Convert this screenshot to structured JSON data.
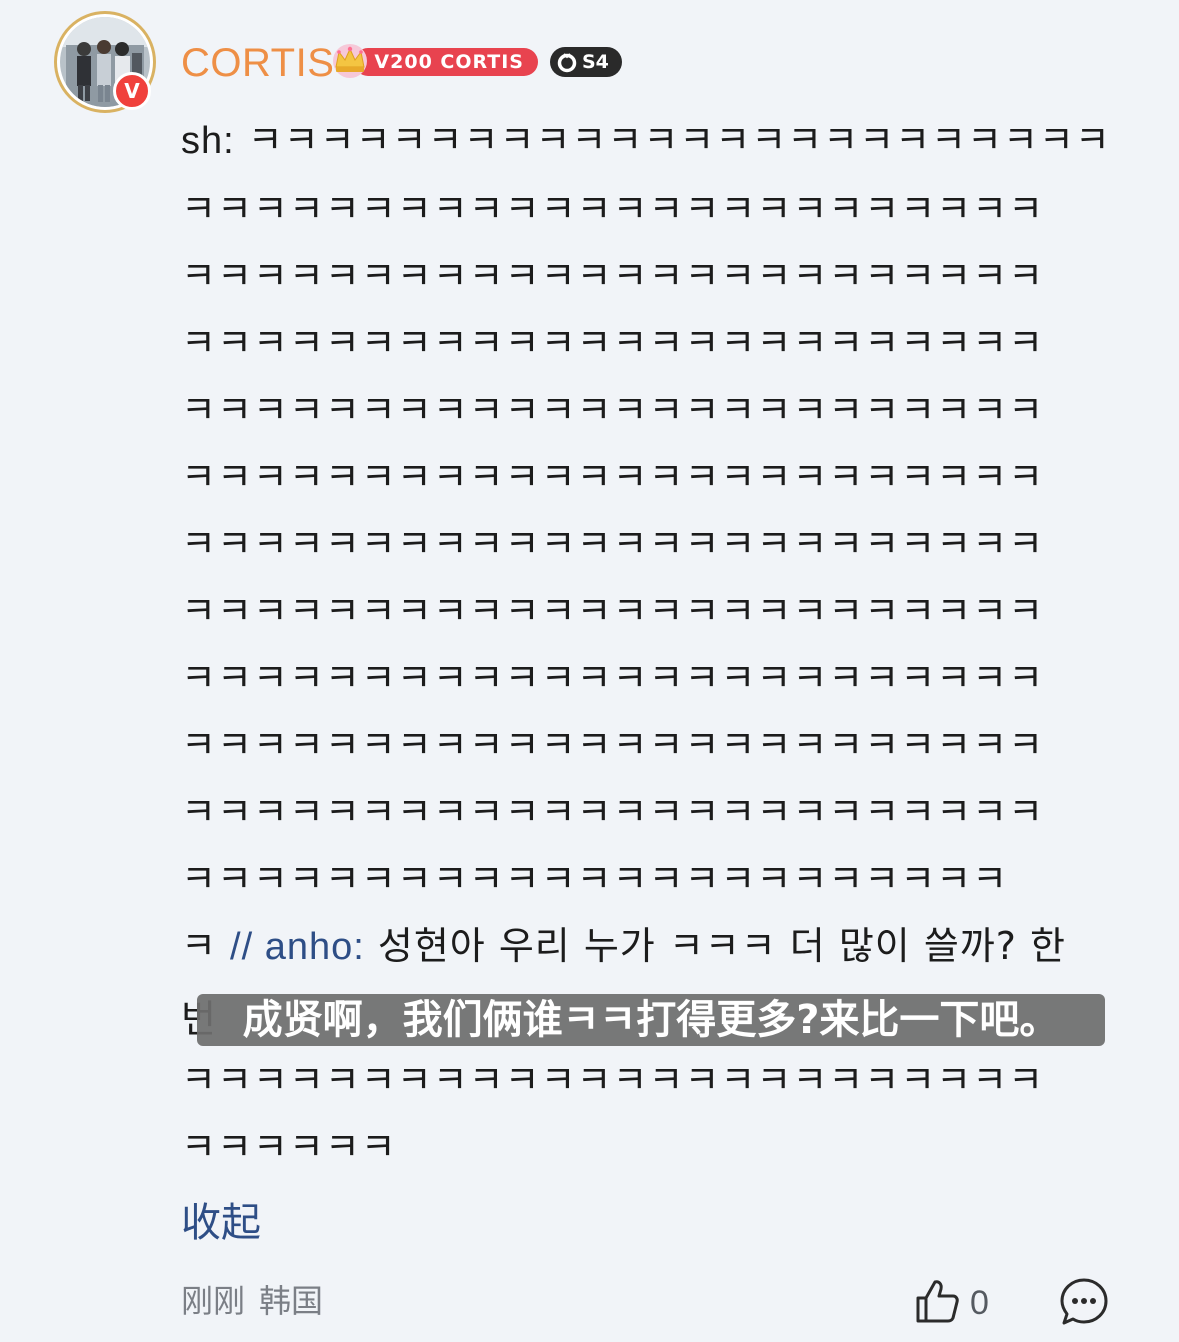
{
  "comment": {
    "author": {
      "name": "CORTIS",
      "verified_badge": "V",
      "vip_label": "V200 CORTIS",
      "level_label": "S4"
    },
    "lines": [
      {
        "speaker": "sh:",
        "text": " ㅋㅋㅋㅋㅋㅋㅋㅋㅋㅋㅋㅋㅋㅋㅋㅋㅋㅋㅋㅋㅋㅋㅋㅋ"
      },
      {
        "text": "ㅋㅋㅋㅋㅋㅋㅋㅋㅋㅋㅋㅋㅋㅋㅋㅋㅋㅋㅋㅋㅋㅋㅋㅋ"
      },
      {
        "text": "ㅋㅋㅋㅋㅋㅋㅋㅋㅋㅋㅋㅋㅋㅋㅋㅋㅋㅋㅋㅋㅋㅋㅋㅋ"
      },
      {
        "text": "ㅋㅋㅋㅋㅋㅋㅋㅋㅋㅋㅋㅋㅋㅋㅋㅋㅋㅋㅋㅋㅋㅋㅋㅋ"
      },
      {
        "text": "ㅋㅋㅋㅋㅋㅋㅋㅋㅋㅋㅋㅋㅋㅋㅋㅋㅋㅋㅋㅋㅋㅋㅋㅋ"
      },
      {
        "text": "ㅋㅋㅋㅋㅋㅋㅋㅋㅋㅋㅋㅋㅋㅋㅋㅋㅋㅋㅋㅋㅋㅋㅋㅋ"
      },
      {
        "text": "ㅋㅋㅋㅋㅋㅋㅋㅋㅋㅋㅋㅋㅋㅋㅋㅋㅋㅋㅋㅋㅋㅋㅋㅋ"
      },
      {
        "text": "ㅋㅋㅋㅋㅋㅋㅋㅋㅋㅋㅋㅋㅋㅋㅋㅋㅋㅋㅋㅋㅋㅋㅋㅋ"
      },
      {
        "text": "ㅋㅋㅋㅋㅋㅋㅋㅋㅋㅋㅋㅋㅋㅋㅋㅋㅋㅋㅋㅋㅋㅋㅋㅋ"
      },
      {
        "text": "ㅋㅋㅋㅋㅋㅋㅋㅋㅋㅋㅋㅋㅋㅋㅋㅋㅋㅋㅋㅋㅋㅋㅋㅋ"
      },
      {
        "text": "ㅋㅋㅋㅋㅋㅋㅋㅋㅋㅋㅋㅋㅋㅋㅋㅋㅋㅋㅋㅋㅋㅋㅋㅋ"
      },
      {
        "text": "ㅋㅋㅋㅋㅋㅋㅋㅋㅋㅋㅋㅋㅋㅋㅋㅋㅋㅋㅋㅋㅋㅋㅋ"
      },
      {
        "prefix": "ㅋ ",
        "mention": "// anho:",
        "text": " 성현아 우리 누가 ㅋㅋㅋ 더 많이 쓸까? 한"
      },
      {
        "text": "번"
      },
      {
        "text": "ㅋㅋㅋㅋㅋㅋㅋㅋㅋㅋㅋㅋㅋㅋㅋㅋㅋㅋㅋㅋㅋㅋㅋㅋ"
      },
      {
        "text": "ㅋㅋㅋㅋㅋㅋ"
      }
    ],
    "translation_overlay": "成贤啊，我们俩谁ㅋㅋ打得更多?来比一下吧。",
    "collapse_label": "收起",
    "timestamp": "刚刚",
    "location": "韩国",
    "like_count": "0"
  },
  "icons": {
    "like": "thumbs-up-icon",
    "reply": "comment-bubble-icon",
    "level": "ring-icon",
    "vip": "crown-icon"
  },
  "colors": {
    "background": "#f1f4f8",
    "username": "#ee8f46",
    "mention": "#2e4e86",
    "vip_badge": "#e8434f",
    "verified_badge": "#f0413c",
    "meta_text": "#7b7f86"
  }
}
